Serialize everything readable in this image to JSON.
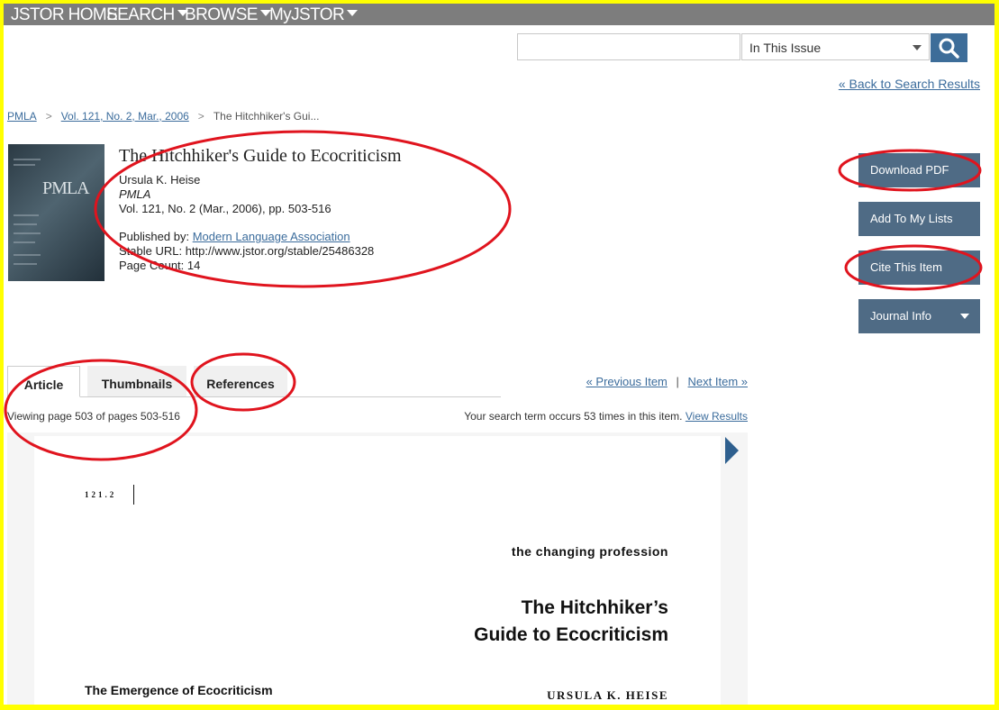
{
  "nav": {
    "home": "JSTOR HOME",
    "search": "SEARCH",
    "browse": "BROWSE",
    "myjstor": "MyJSTOR"
  },
  "search": {
    "query": "",
    "scope": "In This Issue",
    "button_icon": "search-icon"
  },
  "back_link": "« Back to Search Results",
  "breadcrumb": {
    "items": [
      "PMLA",
      "Vol. 121, No. 2, Mar., 2006",
      "The Hitchhiker's Gui..."
    ],
    "separator": ">"
  },
  "cover": {
    "title": "PMLA"
  },
  "article": {
    "title": "The Hitchhiker's Guide to Ecocriticism",
    "author": "Ursula K. Heise",
    "journal": "PMLA",
    "issue": "Vol. 121, No. 2 (Mar., 2006), pp. 503-516",
    "published_by_label": "Published by:",
    "publisher": "Modern Language Association",
    "stable_url": "Stable URL: http://www.jstor.org/stable/25486328",
    "page_count": "Page Count: 14"
  },
  "actions": {
    "download_pdf": "Download PDF",
    "add_to_lists": "Add To My Lists",
    "cite": "Cite This Item",
    "journal_info": "Journal Info"
  },
  "tabs": [
    "Article",
    "Thumbnails",
    "References"
  ],
  "pager": {
    "previous": "« Previous Item",
    "separator": "|",
    "next": "Next Item »"
  },
  "viewing_text": "Viewing page 503 of pages 503-516",
  "search_term": {
    "text": "Your search term occurs 53 times in this item.",
    "link": "View Results"
  },
  "page_content": {
    "page_number": "121.2",
    "section_label": "the changing profession",
    "heading_line1": "The Hitchhiker’s",
    "heading_line2": "Guide to Ecocriticism",
    "section_heading": "The Emergence of Ecocriticism",
    "author": "URSULA K. HEISE"
  },
  "colors": {
    "border_highlight": "#ffff00",
    "annotation": "#e0141e",
    "nav_bg": "#7d7d7d",
    "button_bg": "#4f6b85",
    "link": "#3b6c9c"
  }
}
